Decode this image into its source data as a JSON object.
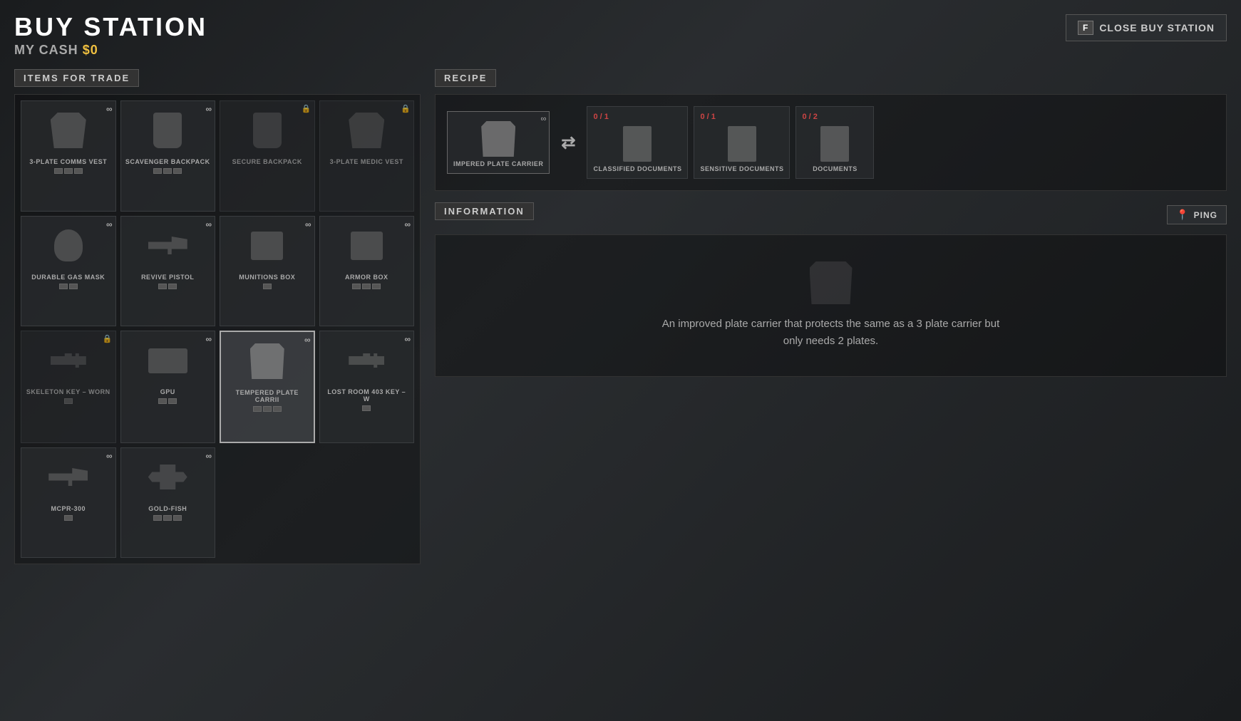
{
  "header": {
    "title": "BUY STATION",
    "cash_label": "MY CASH",
    "cash_value": "$0",
    "close_key": "F",
    "close_label": "CLOSE BUY STATION"
  },
  "left_panel": {
    "section_label": "ITEMS FOR TRADE",
    "items": [
      {
        "id": "3-plate-comms-vest",
        "name": "3-PLATE COMMS VEST",
        "type": "vest",
        "infinity": true,
        "locked": false,
        "pips": 3,
        "pips_filled": 0
      },
      {
        "id": "scavenger-backpack",
        "name": "SCAVENGER BACKPACK",
        "type": "backpack",
        "infinity": true,
        "locked": false,
        "pips": 3,
        "pips_filled": 0
      },
      {
        "id": "secure-backpack",
        "name": "SECURE BACKPACK",
        "type": "backpack",
        "infinity": false,
        "locked": true,
        "pips": 0,
        "pips_filled": 0
      },
      {
        "id": "3-plate-medic-vest",
        "name": "3-PLATE MEDIC VEST",
        "type": "vest",
        "infinity": false,
        "locked": true,
        "pips": 0,
        "pips_filled": 0
      },
      {
        "id": "durable-gas-mask",
        "name": "DURABLE GAS MASK",
        "type": "mask",
        "infinity": true,
        "locked": false,
        "pips": 2,
        "pips_filled": 0
      },
      {
        "id": "revive-pistol",
        "name": "REVIVE PISTOL",
        "type": "gun",
        "infinity": true,
        "locked": false,
        "pips": 2,
        "pips_filled": 0
      },
      {
        "id": "munitions-box",
        "name": "MUNITIONS BOX",
        "type": "box",
        "infinity": true,
        "locked": false,
        "pips": 1,
        "pips_filled": 0
      },
      {
        "id": "armor-box",
        "name": "ARMOR BOX",
        "type": "box",
        "infinity": true,
        "locked": false,
        "pips": 3,
        "pips_filled": 0
      },
      {
        "id": "skeleton-key-worn",
        "name": "SKELETON KEY – WORN",
        "type": "key",
        "infinity": false,
        "locked": true,
        "pips": 1,
        "pips_filled": 0
      },
      {
        "id": "gpu",
        "name": "GPU",
        "type": "gpu",
        "infinity": true,
        "locked": false,
        "pips": 2,
        "pips_filled": 0
      },
      {
        "id": "tempered-plate-carrier",
        "name": "TEMPERED PLATE CARRII",
        "type": "plate-carrier",
        "infinity": true,
        "locked": false,
        "pips": 3,
        "pips_filled": 0,
        "selected": true
      },
      {
        "id": "lost-room-key",
        "name": "LOST ROOM 403 KEY – W",
        "type": "key",
        "infinity": true,
        "locked": false,
        "pips": 1,
        "pips_filled": 0
      },
      {
        "id": "mcpr-300",
        "name": "MCPR-300",
        "type": "gun",
        "infinity": true,
        "locked": false,
        "pips": 1,
        "pips_filled": 0
      },
      {
        "id": "gold-fish",
        "name": "GOLD-FISH",
        "type": "drone",
        "infinity": true,
        "locked": false,
        "pips": 3,
        "pips_filled": 0
      }
    ]
  },
  "recipe_section": {
    "label": "RECIPE",
    "result": {
      "name": "IMPERED PLATE CARRIER",
      "type": "plate-carrier",
      "infinity": true,
      "count_display": "∞"
    },
    "arrow": "⇄",
    "inputs": [
      {
        "name": "CLASSIFIED DOCUMENTS",
        "type": "document",
        "count": "0",
        "total": "1",
        "has_enough": false
      },
      {
        "name": "SENSITIVE DOCUMENTS",
        "type": "document",
        "count": "0",
        "total": "1",
        "has_enough": false
      },
      {
        "name": "DOCUMENTS",
        "type": "document",
        "count": "0",
        "total": "2",
        "has_enough": false
      }
    ]
  },
  "info_section": {
    "label": "INFORMATION",
    "ping_label": "PING",
    "description": "An improved plate carrier that protects the same as a 3 plate carrier but only needs 2 plates."
  },
  "icons": {
    "infinity": "∞",
    "lock": "🔒",
    "ping": "📍"
  }
}
